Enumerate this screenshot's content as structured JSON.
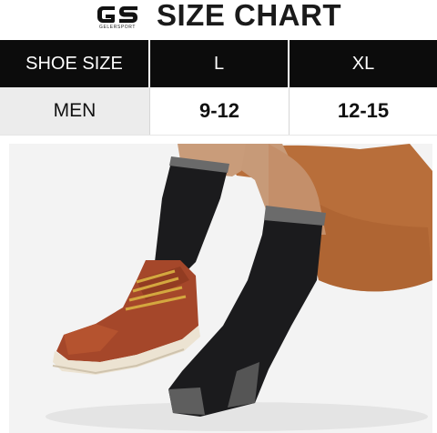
{
  "header": {
    "logo_letters": "GS",
    "logo_subtext": "GELERSPORT",
    "title": "SIZE CHART"
  },
  "size_table": {
    "columns": [
      "SHOE SIZE",
      "L",
      "XL"
    ],
    "rows": [
      {
        "label": "MEN",
        "values": [
          "9-12",
          "12-15"
        ]
      }
    ]
  },
  "photo": {
    "subject": "seated person wearing black crew socks with grey cuffs and heels, one foot in a brown leather boot",
    "colors": {
      "sock": "#1b1b1d",
      "sock_cuff": "#6a6a6a",
      "boot": "#a5472a",
      "shorts": "#b86e3a",
      "skin": "#c79a78",
      "sole": "#ece3d2",
      "background": "#f3f3f3"
    }
  }
}
